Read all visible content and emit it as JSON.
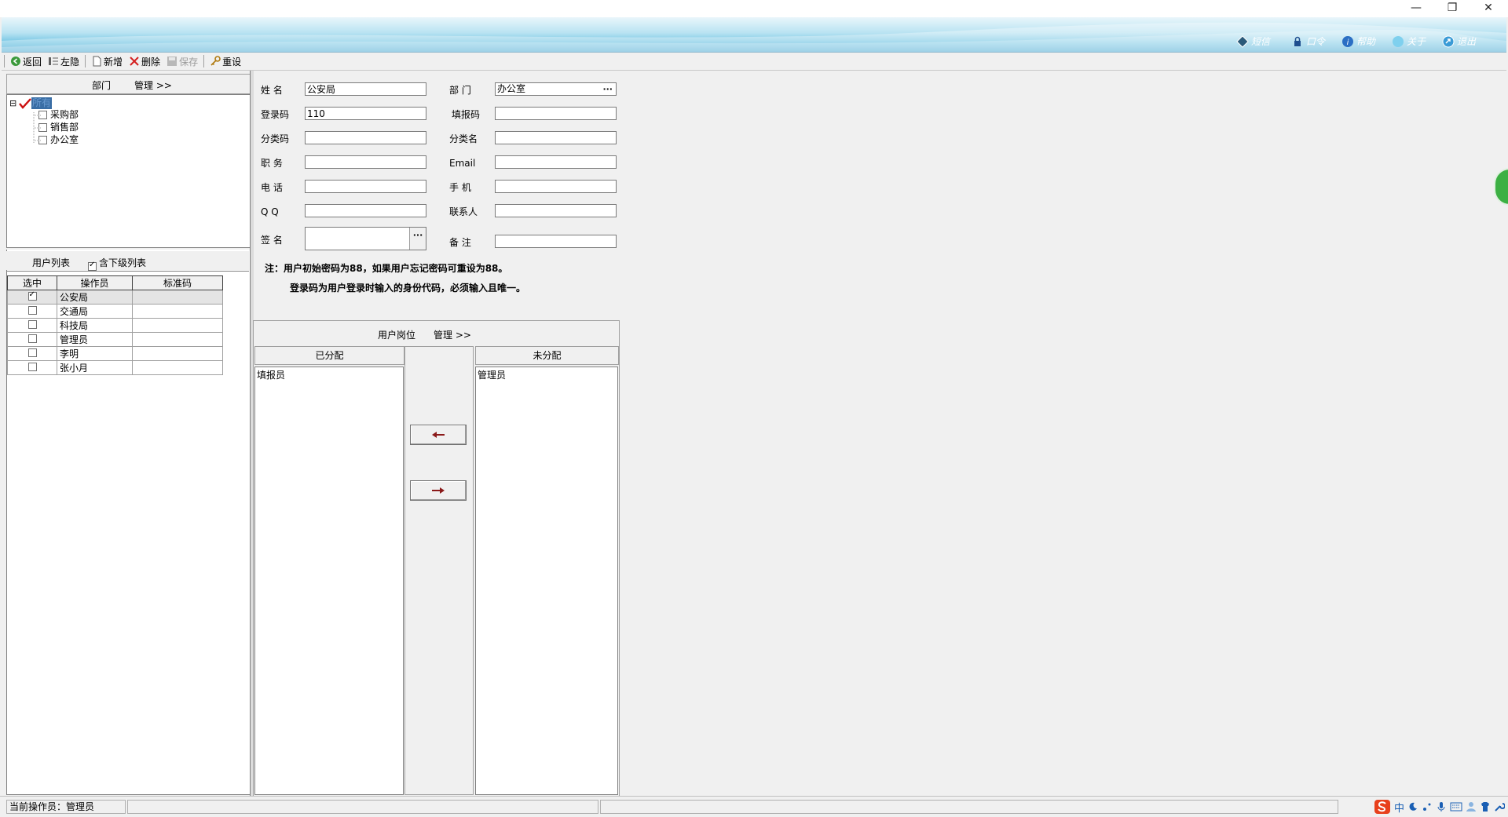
{
  "window": {
    "controls": {
      "minimize": "—",
      "restore": "❐",
      "close": "✕"
    }
  },
  "top_links": [
    {
      "label": "短信",
      "icon": "message-icon"
    },
    {
      "label": "口令",
      "icon": "lock-icon"
    },
    {
      "label": "帮助",
      "icon": "help-icon"
    },
    {
      "label": "关于",
      "icon": "about-icon"
    },
    {
      "label": "退出",
      "icon": "exit-icon"
    }
  ],
  "toolbar": {
    "back": "返回",
    "hide_left": "左隐",
    "new": "新增",
    "delete": "删除",
    "save": "保存",
    "reset": "重设"
  },
  "dept_panel": {
    "title": "部门",
    "manage": "管理 >>",
    "tree": {
      "root": {
        "label": "所有",
        "checked": true,
        "expander": "⊟"
      },
      "children": [
        {
          "label": "采购部",
          "checked": false
        },
        {
          "label": "销售部",
          "checked": false
        },
        {
          "label": "办公室",
          "checked": false
        }
      ]
    }
  },
  "user_list": {
    "title": "用户列表",
    "include_sub_label": "含下级列表",
    "include_sub_checked": true,
    "columns": [
      "选中",
      "操作员",
      "标准码"
    ],
    "rows": [
      {
        "selected": true,
        "operator": "公安局",
        "code": ""
      },
      {
        "selected": false,
        "operator": "交通局",
        "code": ""
      },
      {
        "selected": false,
        "operator": "科技局",
        "code": ""
      },
      {
        "selected": false,
        "operator": "管理员",
        "code": ""
      },
      {
        "selected": false,
        "operator": "李明",
        "code": ""
      },
      {
        "selected": false,
        "operator": "张小月",
        "code": ""
      }
    ]
  },
  "form": {
    "name_label": "姓  名",
    "name_value": "公安局",
    "dept_label": "部  门",
    "dept_value": "办公室",
    "login_label": "登录码",
    "login_value": "110",
    "fill_label": "填报码",
    "fill_value": "",
    "class_code_label": "分类码",
    "class_code_value": "",
    "class_name_label": "分类名",
    "class_name_value": "",
    "post_label": "职  务",
    "post_value": "",
    "email_label": "Email",
    "email_value": "",
    "phone_label": "电  话",
    "phone_value": "",
    "mobile_label": "手  机",
    "mobile_value": "",
    "qq_label": "Q  Q",
    "qq_value": "",
    "contact_label": "联系人",
    "contact_value": "",
    "sign_label": "签  名",
    "sign_value": "",
    "remark_label": "备  注",
    "remark_value": "",
    "ellipsis": "···",
    "note1": "注：用户初始密码为88，如果用户忘记密码可重设为88。",
    "note2": "登录码为用户登录时输入的身份代码，必须输入且唯一。"
  },
  "roles": {
    "title": "用户岗位",
    "manage": "管理 >>",
    "assigned_title": "已分配",
    "unassigned_title": "未分配",
    "assigned": [
      "填报员"
    ],
    "unassigned": [
      "管理员"
    ]
  },
  "status": {
    "current_operator": "当前操作员：管理员"
  },
  "ime": {
    "lang": "中"
  },
  "colors": {
    "banner_dark": "#3aa3cf",
    "arrow": "#8b1a1a"
  }
}
